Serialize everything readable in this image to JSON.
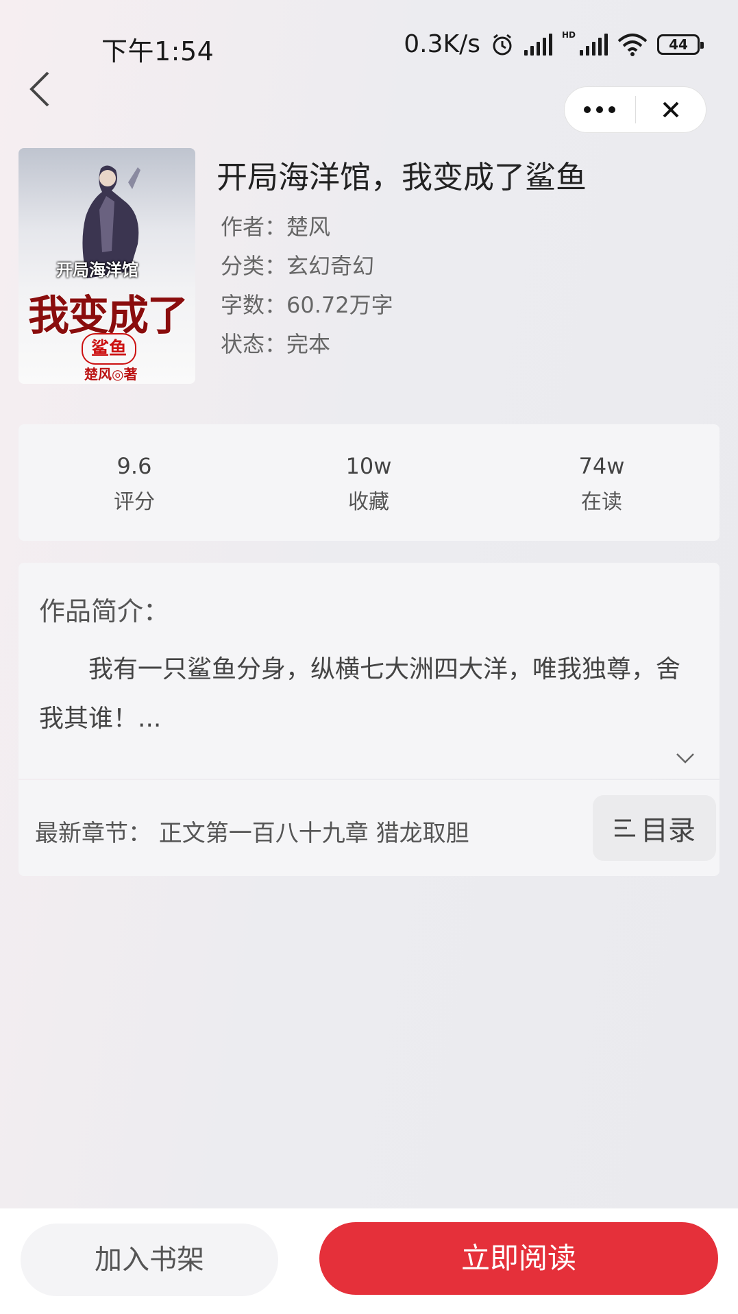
{
  "status_bar": {
    "time": "下午1:54",
    "net_speed": "0.3K/s",
    "hd": "HD",
    "battery": "44"
  },
  "book": {
    "title": "开局海洋馆，我变成了鲨鱼",
    "author_label": "作者：",
    "author": "楚风",
    "category_label": "分类：",
    "category": "玄幻奇幻",
    "word_count_label": "字数：",
    "word_count": "60.72万字",
    "status_label": "状态：",
    "status": "完本"
  },
  "cover": {
    "line1": "开局海洋馆",
    "line2": "我变成了",
    "line3": "鲨鱼",
    "line4": "楚风◎著"
  },
  "stats": [
    {
      "value": "9.6",
      "label": "评分"
    },
    {
      "value": "10w",
      "label": "收藏"
    },
    {
      "value": "74w",
      "label": "在读"
    }
  ],
  "intro": {
    "heading": "作品简介：",
    "text": "我有一只鲨鱼分身，纵横七大洲四大洋，唯我独尊，舍我其谁！..."
  },
  "chapter": {
    "latest": "最新章节：  正文第一百八十九章 猎龙取胆",
    "toc_label": "目录"
  },
  "actions": {
    "add_shelf": "加入书架",
    "read_now": "立即阅读"
  },
  "colors": {
    "accent": "#e5303a"
  }
}
